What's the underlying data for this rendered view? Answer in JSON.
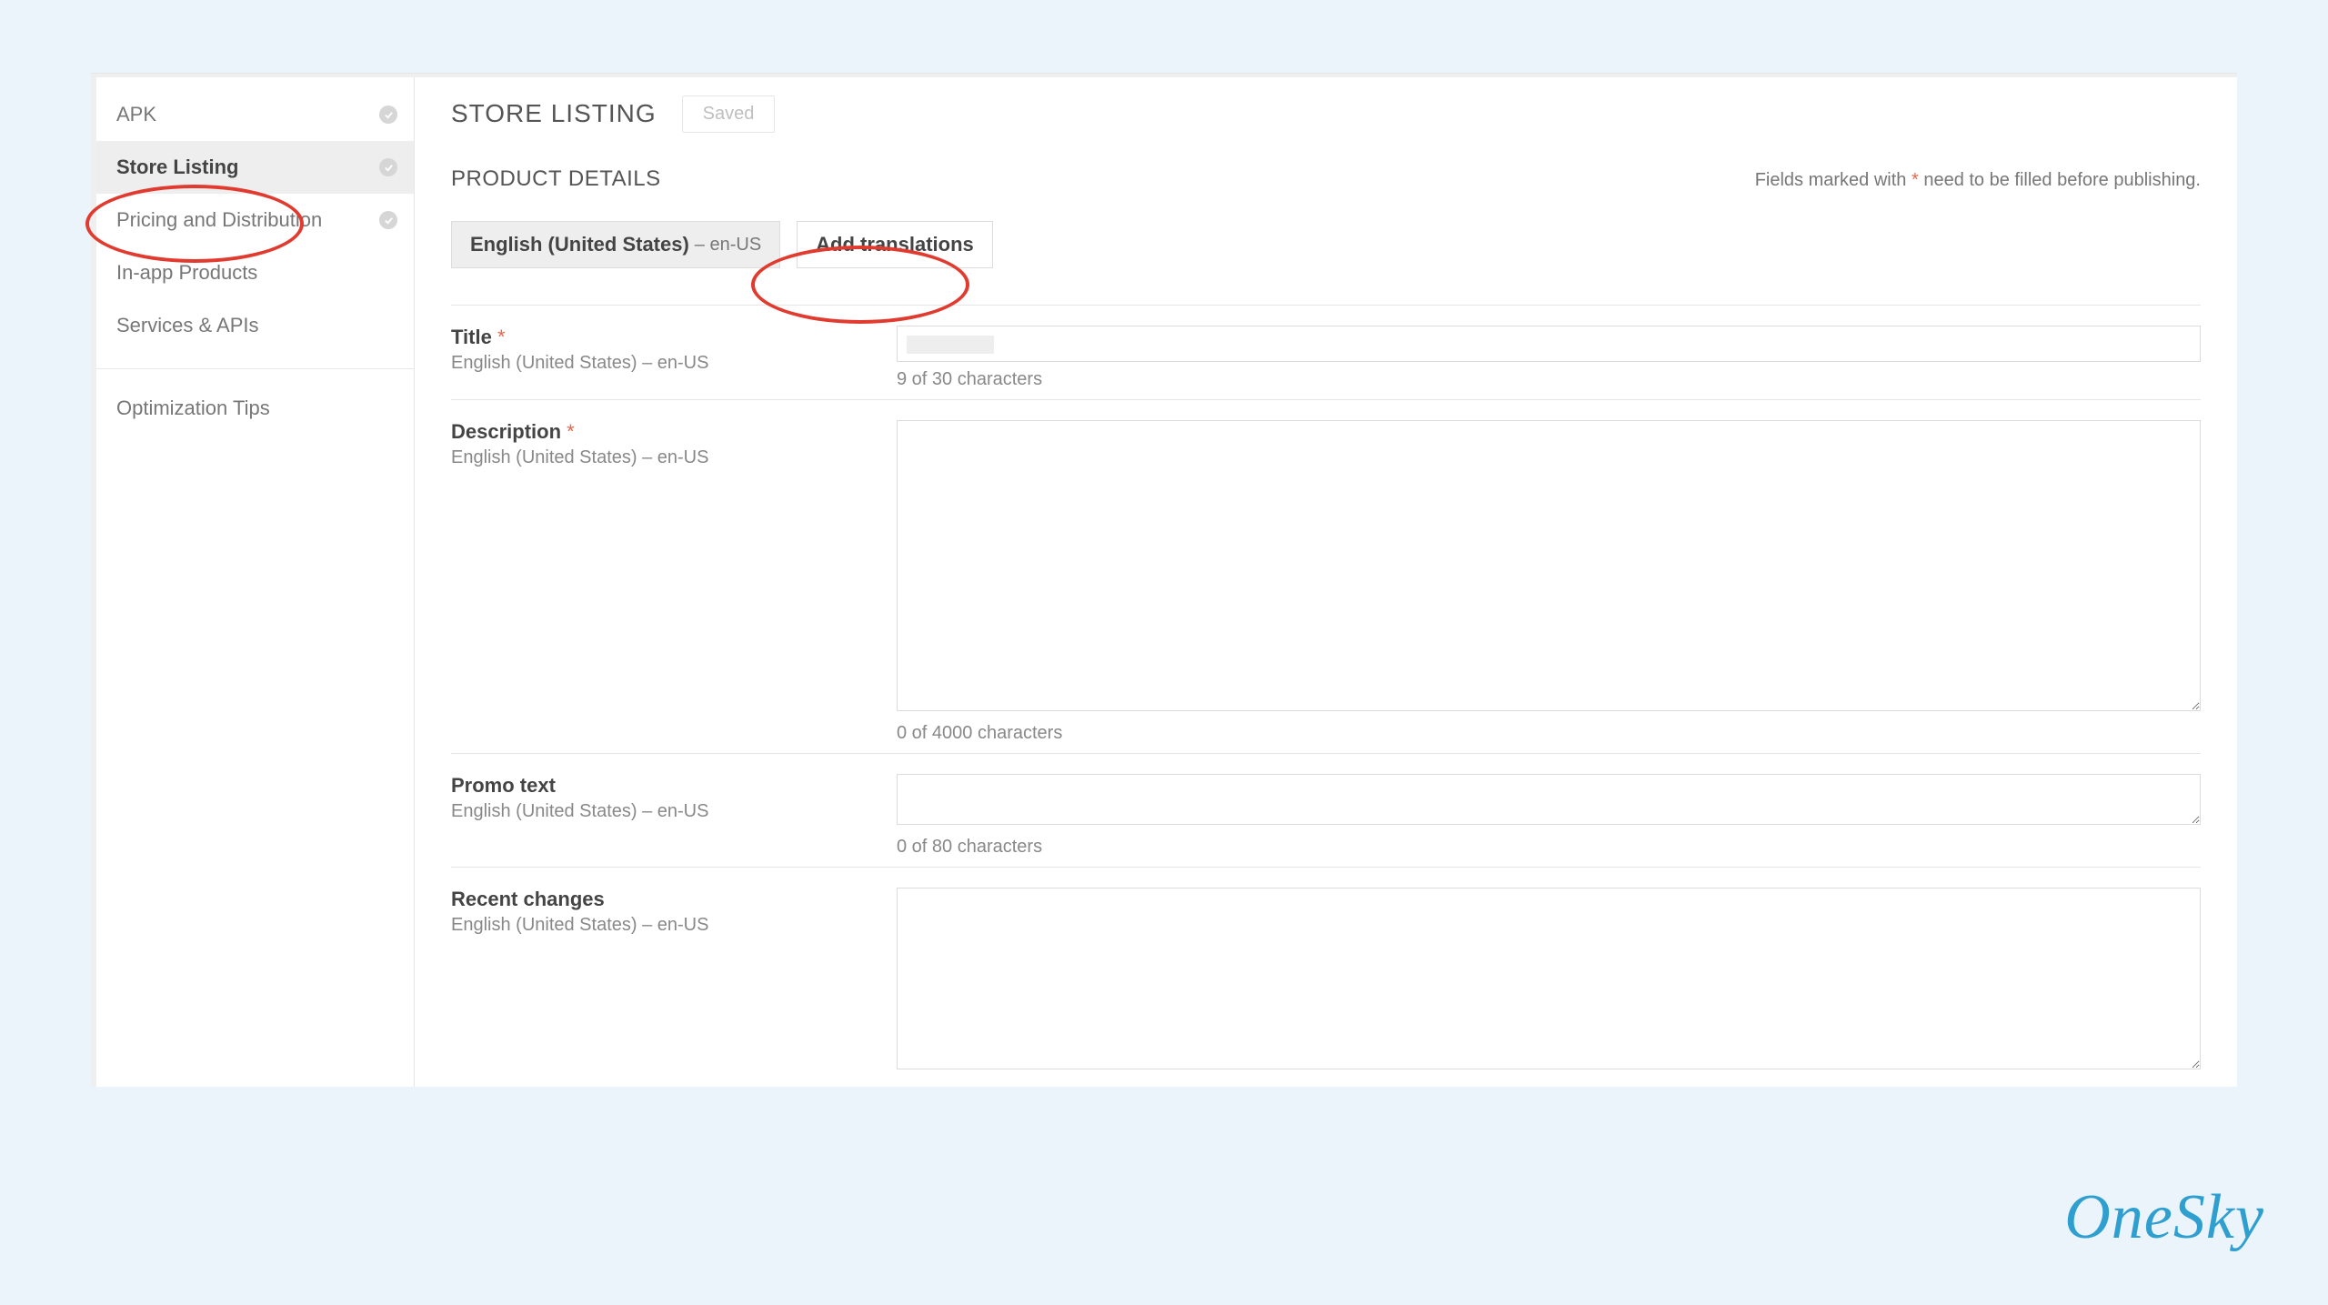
{
  "sidebar": {
    "items": [
      {
        "label": "APK",
        "has_check": true
      },
      {
        "label": "Store Listing",
        "has_check": true
      },
      {
        "label": "Pricing and Distribution",
        "has_check": true
      },
      {
        "label": "In-app Products",
        "has_check": false
      },
      {
        "label": "Services & APIs",
        "has_check": false
      }
    ],
    "tips": "Optimization Tips"
  },
  "header": {
    "title": "STORE LISTING",
    "saved": "Saved"
  },
  "section": {
    "title": "PRODUCT DETAILS",
    "required_note_prefix": "Fields marked with ",
    "required_note_ast": "*",
    "required_note_suffix": " need to be filled before publishing."
  },
  "lang": {
    "current_name": "English (United States)",
    "current_code": "– en-US",
    "add_translations": "Add translations"
  },
  "fields": {
    "title": {
      "label": "Title",
      "required": "*",
      "sub": "English (United States) – en-US",
      "counter": "9 of 30 characters"
    },
    "description": {
      "label": "Description",
      "required": "*",
      "sub": "English (United States) – en-US",
      "counter": "0 of 4000 characters"
    },
    "promo": {
      "label": "Promo text",
      "sub": "English (United States) – en-US",
      "counter": "0 of 80 characters"
    },
    "recent": {
      "label": "Recent changes",
      "sub": "English (United States) – en-US"
    }
  },
  "brand": "OneSky"
}
